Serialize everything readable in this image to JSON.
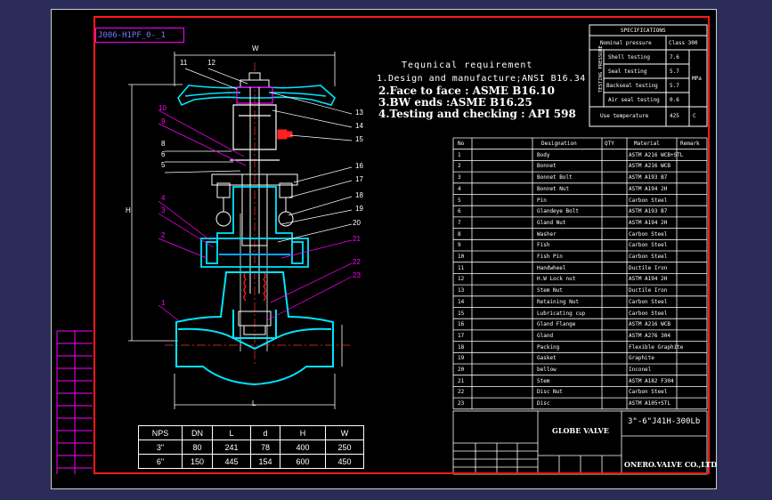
{
  "drawing_id": "J006-H1PF_0-_1",
  "tech_requirements": {
    "title": "Tequnical requirement",
    "items": [
      "1.Design and manufacture;ANSI B16.34",
      "2.Face to face : ASME B16.10",
      "3.BW ends :ASME B16.25",
      "4.Testing and checking : API 598"
    ]
  },
  "specifications": {
    "title": "SPECIFICATIONS",
    "nominal_pressure_label": "Nominal pressure",
    "nominal_pressure_value": "Class 300",
    "test_group_label": "TESTING PRESSURE",
    "rows": [
      {
        "label": "Shell testing",
        "value": "7.6"
      },
      {
        "label": "Seal testing",
        "value": "5.7"
      },
      {
        "label": "Backseal testing",
        "value": "5.7"
      },
      {
        "label": "Air seal testing",
        "value": "0.6"
      }
    ],
    "pressure_unit": "MPa",
    "temp_label": "Use temperature",
    "temp_value": "425",
    "temp_unit": "C"
  },
  "parts_header": {
    "no": "No",
    "designation": "Designation",
    "qty": "QTY",
    "material": "Material",
    "remark": "Remark"
  },
  "parts": [
    {
      "no": "1",
      "designation": "Body",
      "material": "ASTM A216 WCB+STL"
    },
    {
      "no": "2",
      "designation": "Bonnet",
      "material": "ASTM A216 WCB"
    },
    {
      "no": "3",
      "designation": "Bonnet Bolt",
      "material": "ASTM A193 B7"
    },
    {
      "no": "4",
      "designation": "Bonnet Nut",
      "material": "ASTM A194 2H"
    },
    {
      "no": "5",
      "designation": "Pin",
      "material": "Carbon Steel"
    },
    {
      "no": "6",
      "designation": "Glandeye Bolt",
      "material": "ASTM A193 B7"
    },
    {
      "no": "7",
      "designation": "Gland Nut",
      "material": "ASTM A194 2H"
    },
    {
      "no": "8",
      "designation": "Washer",
      "material": "Carbon Steel"
    },
    {
      "no": "9",
      "designation": "Fish",
      "material": "Carbon Steel"
    },
    {
      "no": "10",
      "designation": "Fish Pin",
      "material": "Carbon Steel"
    },
    {
      "no": "11",
      "designation": "Handwheel",
      "material": "Ductile Iron"
    },
    {
      "no": "12",
      "designation": "H.W Lock nut",
      "material": "ASTM A194 2H"
    },
    {
      "no": "13",
      "designation": "Stem Nut",
      "material": "Ductile Iron"
    },
    {
      "no": "14",
      "designation": "Retaining Nut",
      "material": "Carbon Steel"
    },
    {
      "no": "15",
      "designation": "Lubricating cup",
      "material": "Carbon Steel"
    },
    {
      "no": "16",
      "designation": "Gland Flange",
      "material": "ASTM A216 WCB"
    },
    {
      "no": "17",
      "designation": "Gland",
      "material": "ASTM A276 304"
    },
    {
      "no": "18",
      "designation": "Packing",
      "material": "Flexible Graphite"
    },
    {
      "no": "19",
      "designation": "Gasket",
      "material": "Graphite"
    },
    {
      "no": "20",
      "designation": "bellow",
      "material": "Inconel"
    },
    {
      "no": "21",
      "designation": "Stem",
      "material": "ASTM A182 F304"
    },
    {
      "no": "22",
      "designation": "Disc Nut",
      "material": "Carbon Steel"
    },
    {
      "no": "23",
      "designation": "Disc",
      "material": "ASTM A105+STL"
    }
  ],
  "title_block": {
    "model": "3\"-6\"J41H-300Lb",
    "name": "GLOBE VALVE",
    "company": "ONERO.VALVE CO.,LTD"
  },
  "dimensions_table": {
    "headers": [
      "NPS",
      "DN",
      "L",
      "d",
      "H",
      "W"
    ],
    "rows": [
      [
        "3\"",
        "80",
        "241",
        "78",
        "400",
        "250"
      ],
      [
        "6\"",
        "150",
        "445",
        "154",
        "600",
        "450"
      ]
    ]
  },
  "drawing_labels": {
    "W": "W",
    "H": "H",
    "L": "L",
    "callouts": [
      "1",
      "2",
      "3",
      "4",
      "5",
      "6",
      "8",
      "9",
      "10",
      "11",
      "12",
      "13",
      "14",
      "15",
      "16",
      "17",
      "18",
      "19",
      "20",
      "21",
      "22",
      "23"
    ]
  }
}
